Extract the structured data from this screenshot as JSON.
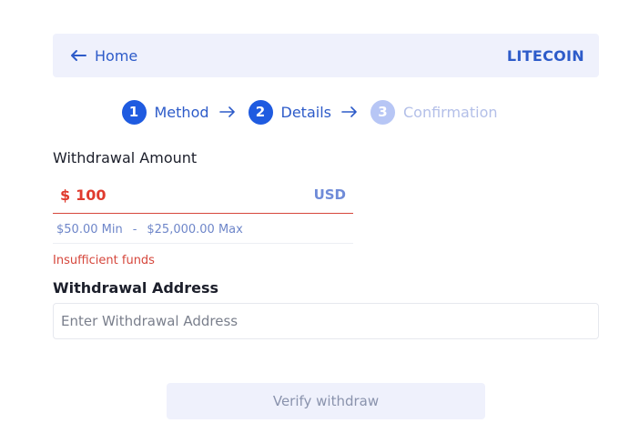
{
  "header": {
    "home_label": "Home",
    "coin": "LITECOIN"
  },
  "stepper": {
    "steps": [
      {
        "number": "1",
        "label": "Method",
        "state": "active"
      },
      {
        "number": "2",
        "label": "Details",
        "state": "active"
      },
      {
        "number": "3",
        "label": "Confirmation",
        "state": "inactive"
      }
    ]
  },
  "amount": {
    "label": "Withdrawal Amount",
    "currency_symbol": "$",
    "value": "100",
    "currency": "USD",
    "min": "$50.00 Min",
    "separator": "-",
    "max": "$25,000.00 Max",
    "error": "Insufficient funds"
  },
  "address": {
    "label": "Withdrawal Address",
    "placeholder": "Enter Withdrawal Address",
    "value": ""
  },
  "actions": {
    "verify_label": "Verify withdraw"
  },
  "colors": {
    "accent": "#1f5be0",
    "error": "#e03b2e",
    "panel_bg": "#eff1fc"
  }
}
